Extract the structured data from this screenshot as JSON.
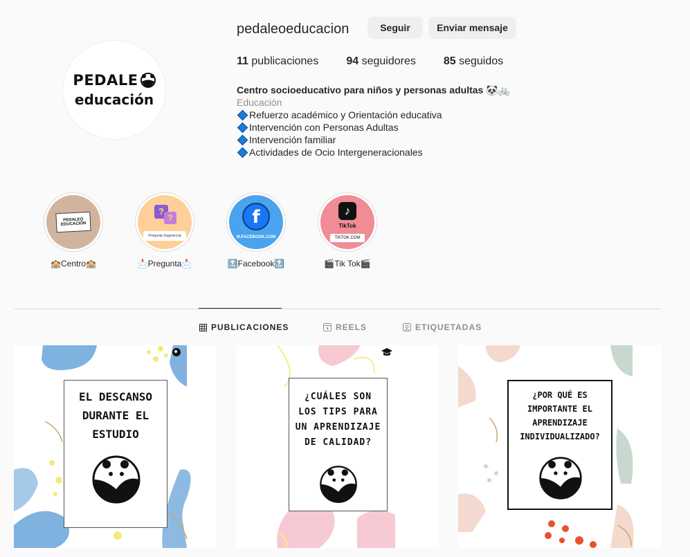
{
  "profile": {
    "username": "pedaleoeducacion",
    "follow_label": "Seguir",
    "message_label": "Enviar mensaje",
    "avatar_line1": "PEDALE",
    "avatar_line2": "educación",
    "stats": {
      "posts_count": "11",
      "posts_label": "publicaciones",
      "followers_count": "94",
      "followers_label": "seguidores",
      "following_count": "85",
      "following_label": "seguidos"
    },
    "bio": {
      "name": "Centro socioeducativo para niños y personas adultas 🐼🚲",
      "category": "Educación",
      "lines": [
        "Refuerzo académico y Orientación educativa",
        "Intervención con Personas Adultas",
        "Intervención familiar",
        "Actividades de Ocio Intergeneracionales"
      ]
    }
  },
  "highlights": [
    {
      "label": "🏫Centro🏫",
      "inner_top": "PEDALEO",
      "inner_bottom": "EDUCACIÓN"
    },
    {
      "label": "📩Pregunta📩",
      "inner_bottom": "Pregunta Sugerencia"
    },
    {
      "label": "🔝Facebook🔝",
      "inner_bottom": "M.FACEBOOK.COM"
    },
    {
      "label": "🎬Tik Tok🎬",
      "inner_top": "TikTok",
      "inner_bottom": "TIKTOK.COM"
    }
  ],
  "tabs": [
    {
      "label": "PUBLICACIONES",
      "icon": "grid-icon"
    },
    {
      "label": "REELS",
      "icon": "reels-icon"
    },
    {
      "label": "ETIQUETADAS",
      "icon": "tagged-icon"
    }
  ],
  "posts": [
    {
      "text": "EL DESCANSO DURANTE EL ESTUDIO",
      "badge_icon": "head-gear-icon"
    },
    {
      "text": "¿CUÁLES SON LOS TIPS PARA UN APRENDIZAJE DE CALIDAD?",
      "badge_icon": "graduation-cap-icon"
    },
    {
      "text": "¿POR QUÉ ES IMPORTANTE EL APRENDIZAJE INDIVIDUALIZADO?",
      "badge_icon": ""
    }
  ],
  "colors": {
    "background": "#fafafa",
    "button": "#efefef",
    "diamond": "#1e7bd6",
    "facebook": "#1877f2",
    "tiktok_bg": "#f08c96"
  }
}
